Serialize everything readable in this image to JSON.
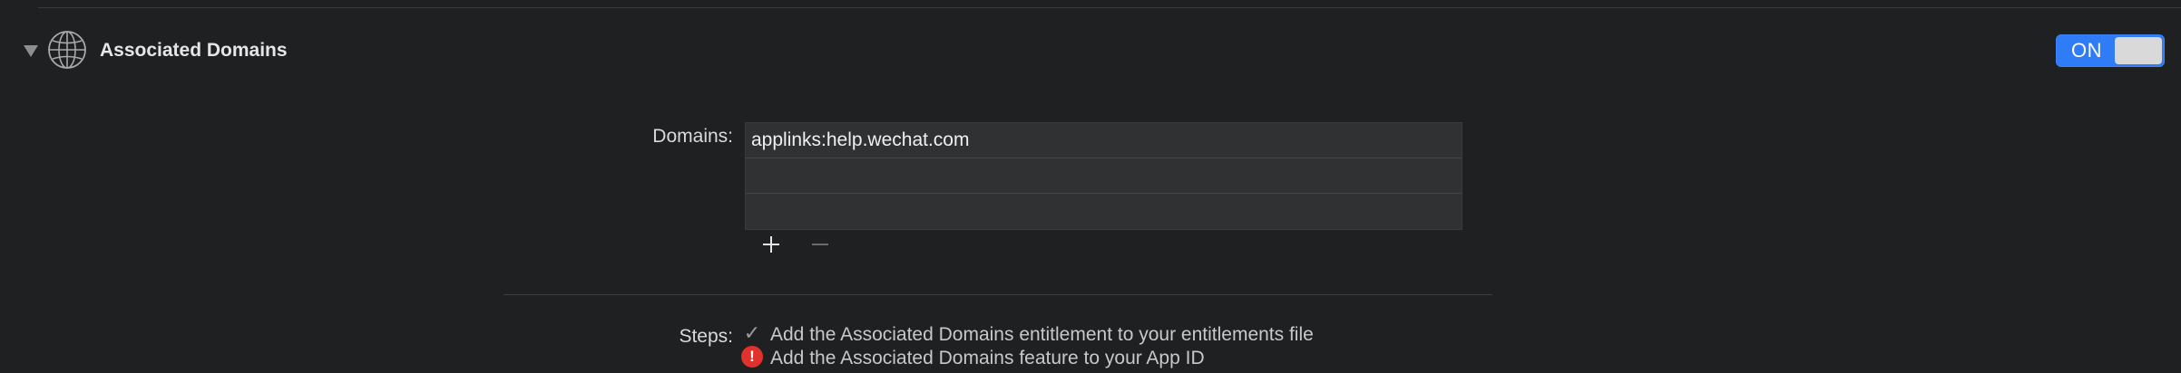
{
  "section": {
    "title": "Associated Domains",
    "icon": "globe-icon",
    "expanded": true,
    "toggle_label": "ON",
    "toggle_state": "on"
  },
  "domains": {
    "label": "Domains:",
    "rows": [
      "applinks:help.wechat.com",
      "",
      ""
    ],
    "add_icon": "plus-icon",
    "remove_icon": "minus-icon"
  },
  "steps": {
    "label": "Steps:",
    "items": [
      {
        "status": "done",
        "icon": "checkmark-icon",
        "glyph": "✓",
        "text": "Add the Associated Domains entitlement to your entitlements file"
      },
      {
        "status": "error",
        "icon": "error-icon",
        "glyph": "!",
        "text": "Add the Associated Domains feature to your App ID"
      }
    ]
  },
  "colors": {
    "background": "#1f2022",
    "toggle_on": "#2f7cf6",
    "error": "#e0312d"
  }
}
